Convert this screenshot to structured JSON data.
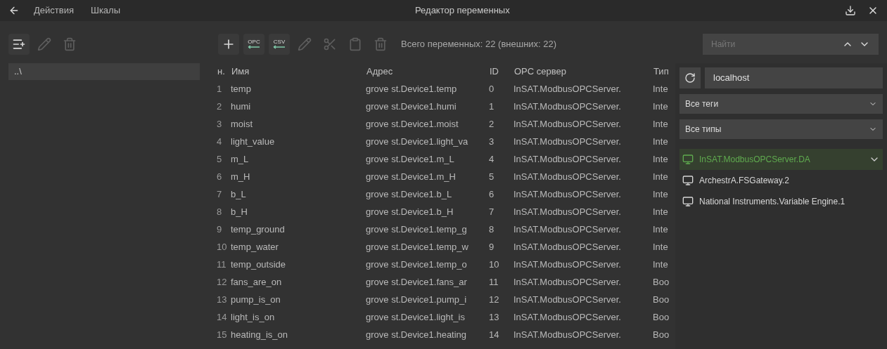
{
  "window": {
    "title": "Редактор переменных",
    "menu": [
      "Действия",
      "Шкалы"
    ]
  },
  "left_toolbar": [
    {
      "kind": "add-list",
      "disabled": false
    },
    {
      "kind": "edit",
      "disabled": true
    },
    {
      "kind": "delete",
      "disabled": true
    }
  ],
  "left_list": [
    {
      "label": "..\\",
      "selected": true
    }
  ],
  "toolbar": [
    {
      "kind": "add",
      "disabled": false
    },
    {
      "kind": "import",
      "label": "OPC",
      "disabled": false
    },
    {
      "kind": "import",
      "label": "CSV",
      "disabled": false
    },
    {
      "kind": "edit",
      "disabled": true
    },
    {
      "kind": "cut",
      "disabled": true
    },
    {
      "kind": "paste",
      "disabled": true
    },
    {
      "kind": "delete",
      "disabled": true
    }
  ],
  "summary": "Всего переменных: 22 (внешних: 22)",
  "search": {
    "placeholder": "Найти"
  },
  "table": {
    "columns": [
      "н.",
      "Имя",
      "Адрес",
      "ID",
      "OPC сервер",
      "Тип"
    ],
    "rows": [
      [
        "1",
        "temp",
        "grove st.Device1.temp",
        "0",
        "InSAT.ModbusOPCServer.",
        "Inte"
      ],
      [
        "2",
        "humi",
        "grove st.Device1.humi",
        "1",
        "InSAT.ModbusOPCServer.",
        "Inte"
      ],
      [
        "3",
        "moist",
        "grove st.Device1.moist",
        "2",
        "InSAT.ModbusOPCServer.",
        "Inte"
      ],
      [
        "4",
        "light_value",
        "grove st.Device1.light_va",
        "3",
        "InSAT.ModbusOPCServer.",
        "Inte"
      ],
      [
        "5",
        "m_L",
        "grove st.Device1.m_L",
        "4",
        "InSAT.ModbusOPCServer.",
        "Inte"
      ],
      [
        "6",
        "m_H",
        "grove st.Device1.m_H",
        "5",
        "InSAT.ModbusOPCServer.",
        "Inte"
      ],
      [
        "7",
        "b_L",
        "grove st.Device1.b_L",
        "6",
        "InSAT.ModbusOPCServer.",
        "Inte"
      ],
      [
        "8",
        "b_H",
        "grove st.Device1.b_H",
        "7",
        "InSAT.ModbusOPCServer.",
        "Inte"
      ],
      [
        "9",
        "temp_ground",
        "grove st.Device1.temp_g",
        "8",
        "InSAT.ModbusOPCServer.",
        "Inte"
      ],
      [
        "10",
        "temp_water",
        "grove st.Device1.temp_w",
        "9",
        "InSAT.ModbusOPCServer.",
        "Inte"
      ],
      [
        "11",
        "temp_outside",
        "grove st.Device1.temp_o",
        "10",
        "InSAT.ModbusOPCServer.",
        "Inte"
      ],
      [
        "12",
        "fans_are_on",
        "grove st.Device1.fans_ar",
        "11",
        "InSAT.ModbusOPCServer.",
        "Boo"
      ],
      [
        "13",
        "pump_is_on",
        "grove st.Device1.pump_i",
        "12",
        "InSAT.ModbusOPCServer.",
        "Boo"
      ],
      [
        "14",
        "light_is_on",
        "grove st.Device1.light_is",
        "13",
        "InSAT.ModbusOPCServer.",
        "Boo"
      ],
      [
        "15",
        "heating_is_on",
        "grove st.Device1.heating",
        "14",
        "InSAT.ModbusOPCServer.",
        "Boo"
      ]
    ]
  },
  "opc_panel": {
    "host": "localhost",
    "filters": [
      "Все теги",
      "Все типы"
    ],
    "servers": [
      {
        "label": "InSAT.ModbusOPCServer.DA",
        "selected": true,
        "expanded": false
      },
      {
        "label": "ArchestrA.FSGateway.2",
        "selected": false
      },
      {
        "label": "National Instruments.Variable Engine.1",
        "selected": false
      }
    ]
  }
}
